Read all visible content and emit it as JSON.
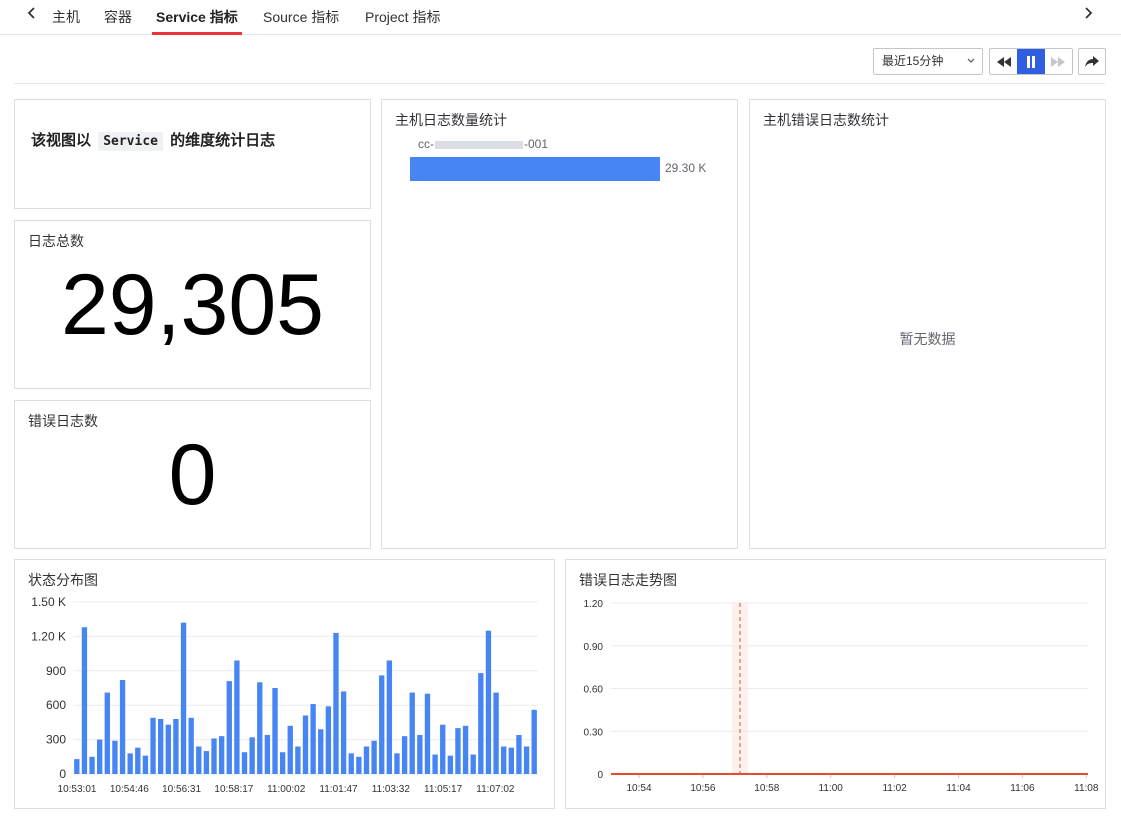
{
  "tabs": {
    "items": [
      {
        "label": "主机",
        "active": false
      },
      {
        "label": "容器",
        "active": false
      },
      {
        "label": "Service 指标",
        "active": true
      },
      {
        "label": "Source 指标",
        "active": false
      },
      {
        "label": "Project 指标",
        "active": false
      }
    ],
    "prev_icon": "chevron-left-icon",
    "next_icon": "chevron-right-icon"
  },
  "toolbar": {
    "time_range": "最近15分钟",
    "buttons": [
      "rewind-icon",
      "pause-icon",
      "fast-forward-icon",
      "share-icon"
    ],
    "accent_color": "#2f5ee0"
  },
  "description": {
    "prefix": "该视图以",
    "code": "Service",
    "suffix": "的维度统计日志"
  },
  "total_logs": {
    "title": "日志总数",
    "value": "29,305"
  },
  "error_logs": {
    "title": "错误日志数",
    "value": "0"
  },
  "host_log_stats": {
    "title": "主机日志数量统计",
    "host_prefix": "cc-",
    "host_suffix": "-001",
    "value_label": "29.30 K",
    "fraction": 0.857,
    "bar_color": "#4785f5"
  },
  "host_error_stats": {
    "title": "主机错误日志数统计",
    "empty_text": "暂无数据"
  },
  "status_chart": {
    "title": "状态分布图"
  },
  "error_trend": {
    "title": "错误日志走势图"
  },
  "chart_data": [
    {
      "type": "bar",
      "title": "状态分布图",
      "color": "#4785f5",
      "ylim": [
        0,
        1500
      ],
      "y_ticks": [
        0,
        300,
        600,
        900,
        1200,
        1500
      ],
      "y_tick_labels": [
        "0",
        "300",
        "600",
        "900",
        "1.20 K",
        "1.50 K"
      ],
      "x_tick_labels": [
        "10:53:01",
        "10:54:46",
        "10:56:31",
        "10:58:17",
        "11:00:02",
        "11:01:47",
        "11:03:32",
        "11:05:17",
        "11:07:02"
      ],
      "values": [
        130,
        1280,
        150,
        300,
        710,
        290,
        820,
        180,
        230,
        160,
        490,
        480,
        430,
        480,
        1320,
        490,
        240,
        200,
        310,
        330,
        810,
        990,
        190,
        320,
        800,
        340,
        750,
        190,
        420,
        240,
        510,
        610,
        390,
        590,
        1230,
        720,
        180,
        150,
        240,
        290,
        860,
        990,
        180,
        330,
        710,
        340,
        700,
        170,
        430,
        160,
        400,
        420,
        170,
        880,
        1250,
        710,
        240,
        230,
        340,
        240,
        560
      ],
      "grid": true
    },
    {
      "type": "line",
      "title": "错误日志走势图",
      "color": "#e84b2c",
      "ylim": [
        0,
        1.2
      ],
      "y_ticks": [
        0,
        0.3,
        0.6,
        0.9,
        1.2
      ],
      "y_tick_labels": [
        "0",
        "0.30",
        "0.60",
        "0.90",
        "1.20"
      ],
      "x_tick_labels": [
        "10:54",
        "10:56",
        "10:58",
        "11:00",
        "11:02",
        "11:04",
        "11:06",
        "11:08"
      ],
      "series": [
        {
          "values": [
            0,
            0,
            0,
            0,
            0,
            0,
            0,
            0
          ]
        }
      ],
      "marker_line_at": "10:57:10",
      "grid": true
    }
  ]
}
